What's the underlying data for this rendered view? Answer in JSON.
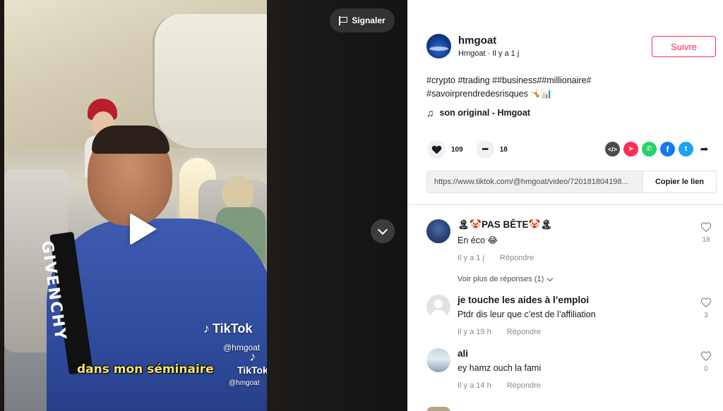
{
  "video": {
    "report_label": "Signaler",
    "watermark_brand": "TikTok",
    "watermark_handle": "@hmgoat",
    "watermark_brand_small": "TikTok",
    "watermark_handle_small": "@hmgoat",
    "caption": "dans mon séminaire",
    "stripe_text": "GIVENCHY"
  },
  "author": {
    "username": "hmgoat",
    "display_name": "Hmgoat",
    "time_ago": "Il y a 1 j",
    "follow_label": "Suivre"
  },
  "post": {
    "description_line1": "#crypto #trading ##business##millionaire#",
    "description_line2": "#savoirprendredesrisques 🤸📊",
    "music": "son original - Hmgoat",
    "likes": "109",
    "comments": "18",
    "link_url": "https://www.tiktok.com/@hmgoat/video/720181804198...",
    "copy_label": "Copier le lien"
  },
  "share_icons": [
    "embed-icon",
    "send-icon",
    "whatsapp-icon",
    "facebook-icon",
    "twitter-icon",
    "share-arrow-icon"
  ],
  "comments": [
    {
      "name": "🏝🤡PAS BÊTE🤡🏝",
      "text": "En éco 😂",
      "time": "Il y a 1 j",
      "reply_label": "Répondre",
      "likes": "18",
      "more_replies": "Voir plus de réponses (1)"
    },
    {
      "name": "je touche les aides à l’emploi",
      "text": "Ptdr dis leur que c’est de l’affiliation",
      "time": "Il y a 19 h",
      "reply_label": "Répondre",
      "likes": "3"
    },
    {
      "name": "ali",
      "text": "ey hamz ouch la fami",
      "time": "Il y a 14 h",
      "reply_label": "Répondre",
      "likes": "0"
    }
  ],
  "colors": {
    "accent": "#fe2c55",
    "text": "#161823",
    "muted": "#8a8b91",
    "caption_yellow": "#f4e46a"
  }
}
